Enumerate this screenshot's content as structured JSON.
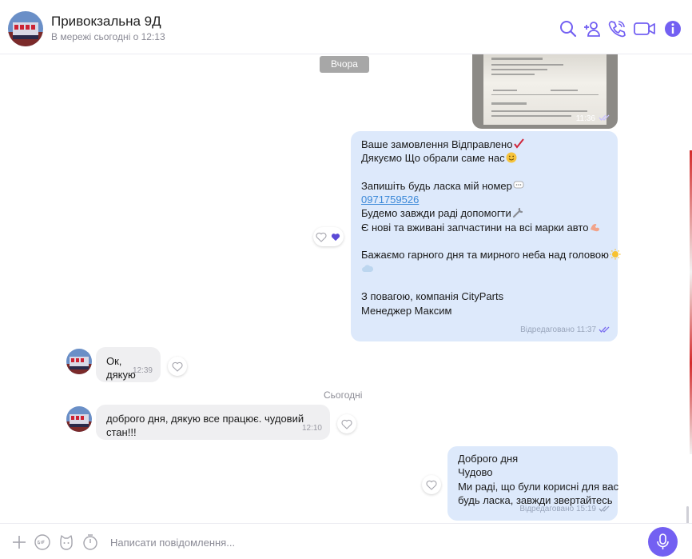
{
  "header": {
    "title": "Привокзальна 9Д",
    "status": "В мережі сьогодні о 12:13",
    "icons": [
      "search-icon",
      "add-participant-icon",
      "call-icon",
      "video-call-icon",
      "info-icon"
    ]
  },
  "colors": {
    "accent": "#7360f2",
    "outgoing_bubble": "#dde9fb",
    "incoming_bubble": "#efeff1",
    "link": "#3a88d8"
  },
  "messages": {
    "date_yesterday": "Вчора",
    "date_today": "Сьогодні",
    "photo_message": {
      "time": "11:36"
    },
    "order_message": {
      "lines": [
        "Ваше замовлення Відправлено",
        "Дякуємо Що обрали саме нас",
        "",
        "Запишіть будь ласка мій номер",
        "0971759526",
        "Будемо завжди раді допомогти",
        "Є нові та вживані запчастини на всі марки авто",
        "",
        "Бажаємо гарного дня та мирного неба над головою",
        "",
        "",
        "З повагою, компанія CityParts",
        "Менеджер Максим"
      ],
      "meta": "Відредаговано 11:37"
    },
    "reply_ok": {
      "text": "Ок, дякую",
      "time": "12:39"
    },
    "reply_today": {
      "text": "доброго дня, дякую все працює. чудовий стан!!!",
      "time": "12:10"
    },
    "last_message": {
      "lines": [
        "Доброго дня",
        "Чудово",
        "Ми раді, що були корисні для вас",
        "будь ласка, завжди звертайтесь"
      ],
      "meta": "Відредаговано 15:19"
    }
  },
  "composer": {
    "placeholder": "Написати повідомлення...",
    "icons": [
      "plus-icon",
      "gif-icon",
      "sticker-icon",
      "timer-icon",
      "mic-icon"
    ]
  }
}
